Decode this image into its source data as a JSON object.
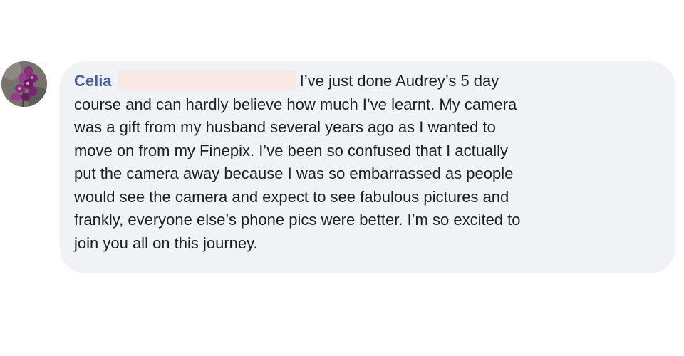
{
  "comment": {
    "author_name": "Celia",
    "avatar_icon": "orchid-flower-avatar",
    "redaction_color": "#f8e9e4",
    "author_color": "#4a5fa0",
    "bubble_color": "#f1f2f6",
    "lines": [
      "I’ve just done Audrey’s 5 day",
      "course and can hardly believe how much I’ve learnt. My camera",
      "was a gift from my husband several years ago as I wanted to",
      "move on from my Finepix. I’ve been so confused that I actually",
      "put the camera away because I was so embarrassed as people",
      "would see the camera and expect to see fabulous pictures and",
      "frankly, everyone else’s phone pics were better. I’m so excited to",
      "join you all on this journey."
    ]
  }
}
